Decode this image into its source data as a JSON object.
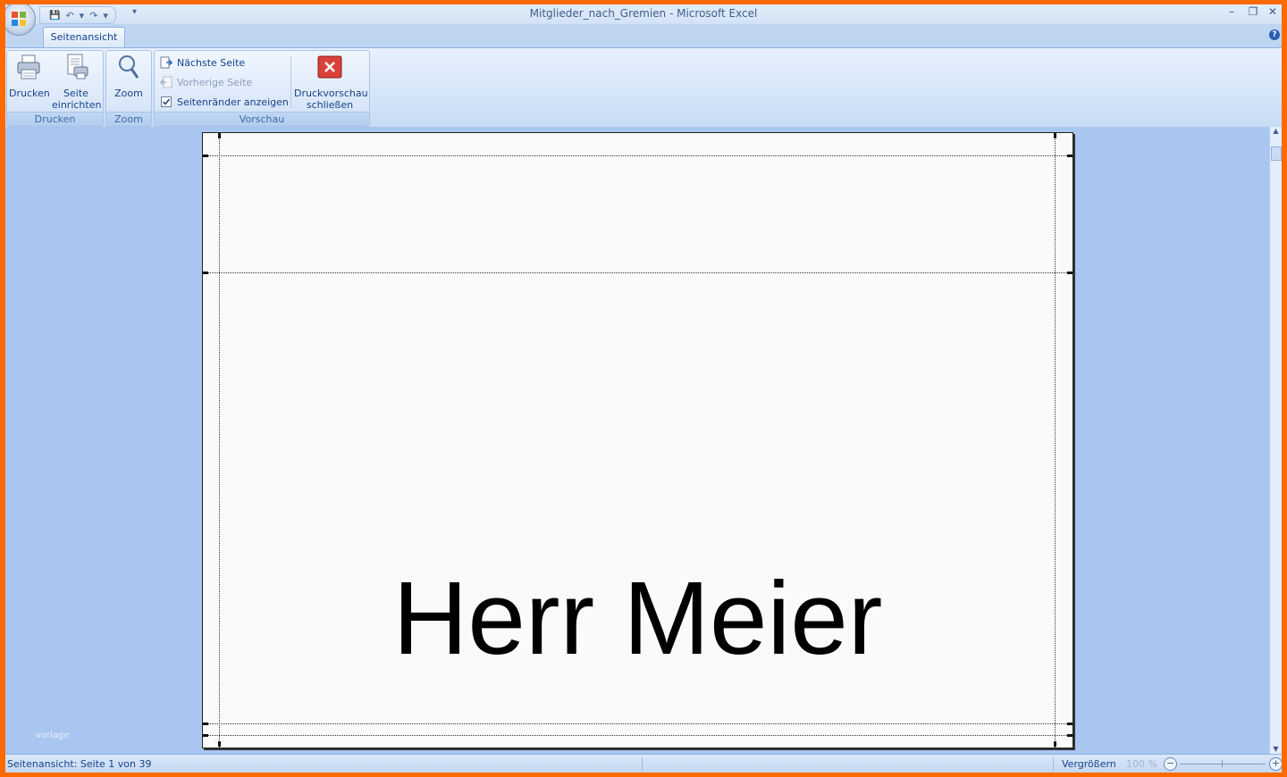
{
  "window": {
    "title": "Mitglieder_nach_Gremien - Microsoft Excel",
    "controls": {
      "minimize": "–",
      "restore": "❐",
      "close": "✕"
    }
  },
  "quick_access": {
    "save": "💾",
    "undo": "↶",
    "undo_drop": "▾",
    "redo": "↷",
    "redo_drop": "▾",
    "customize": "▾"
  },
  "tabs": [
    {
      "label": "Seitenansicht",
      "active": true
    }
  ],
  "help": "?",
  "ribbon": {
    "groups": {
      "drucken": {
        "label": "Drucken",
        "print_label": "Drucken",
        "page_setup_label_1": "Seite",
        "page_setup_label_2": "einrichten"
      },
      "zoom": {
        "label": "Zoom",
        "zoom_label": "Zoom"
      },
      "vorschau": {
        "label": "Vorschau",
        "next_page": "Nächste Seite",
        "prev_page": "Vorherige Seite",
        "show_margins": "Seitenränder anzeigen",
        "show_margins_checked": true,
        "close_preview_1": "Druckvorschau",
        "close_preview_2": "schließen"
      }
    }
  },
  "page": {
    "cell_text": "Herr Meier"
  },
  "watermark": "vorlage",
  "statusbar": {
    "text": "Seitenansicht: Seite 1 von 39",
    "zoom_label": "Vergrößern",
    "zoom_level": "100 %",
    "zoom_out": "−",
    "zoom_in": "+"
  },
  "colors": {
    "frame": "#ff6a00",
    "preview_bg": "#a8c6ef",
    "ribbon_text": "#15428b"
  }
}
